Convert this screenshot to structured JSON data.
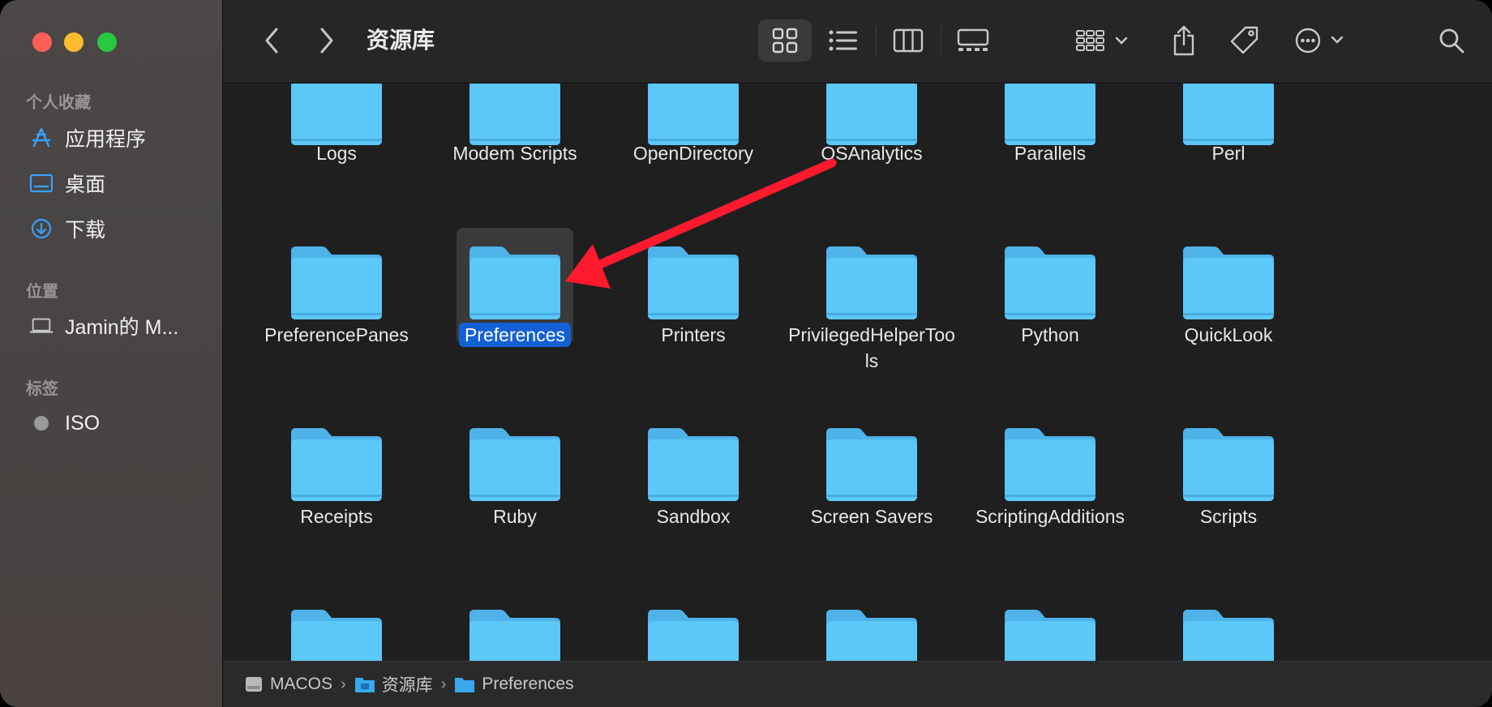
{
  "window": {
    "title": "资源库"
  },
  "sidebar": {
    "favorites_header": "个人收藏",
    "favorites": [
      {
        "label": "应用程序",
        "icon": "applications-icon"
      },
      {
        "label": "桌面",
        "icon": "desktop-icon"
      },
      {
        "label": "下载",
        "icon": "downloads-icon"
      }
    ],
    "locations_header": "位置",
    "locations": [
      {
        "label": "Jamin的 M...",
        "icon": "laptop-icon"
      }
    ],
    "tags_header": "标签",
    "tags": [
      {
        "label": "ISO",
        "color": "#9a9a9a"
      }
    ]
  },
  "toolbar": {
    "icons": [
      "back-icon",
      "forward-icon",
      "icon-view-icon",
      "list-view-icon",
      "column-view-icon",
      "gallery-view-icon",
      "group-icon",
      "share-icon",
      "tag-icon",
      "more-actions-icon",
      "search-icon"
    ],
    "active_view": "icon-view"
  },
  "folders": {
    "row1": [
      "Logs",
      "Modem Scripts",
      "OpenDirectory",
      "OSAnalytics",
      "Parallels",
      "Perl"
    ],
    "row2": [
      "PreferencePanes",
      "Preferences",
      "Printers",
      "PrivilegedHelperTools",
      "Python",
      "QuickLook"
    ],
    "row3": [
      "Receipts",
      "Ruby",
      "Sandbox",
      "Screen Savers",
      "ScriptingAdditions",
      "Scripts"
    ],
    "selected": "Preferences",
    "folder_color": "#5cc8f8"
  },
  "pathbar": {
    "items": [
      "MACOS",
      "资源库",
      "Preferences"
    ]
  },
  "annotation": {
    "arrow_color": "#ff1a2e"
  }
}
